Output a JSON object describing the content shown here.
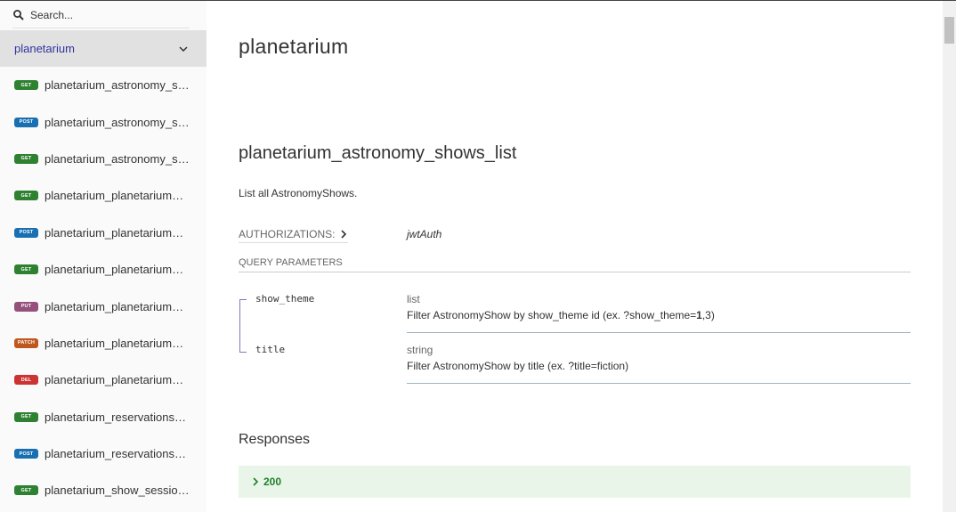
{
  "sidebar": {
    "search_placeholder": "Search...",
    "group_label": "planetarium",
    "operations": [
      {
        "method": "GET",
        "label": "planetarium_astronomy_shows_list"
      },
      {
        "method": "POST",
        "label": "planetarium_astronomy_shows_create"
      },
      {
        "method": "GET",
        "label": "planetarium_astronomy_shows_retrieve"
      },
      {
        "method": "GET",
        "label": "planetarium_planetarium_domes_list"
      },
      {
        "method": "POST",
        "label": "planetarium_planetarium_domes_create"
      },
      {
        "method": "GET",
        "label": "planetarium_planetarium_domes_retrieve"
      },
      {
        "method": "PUT",
        "label": "planetarium_planetarium_domes_update"
      },
      {
        "method": "PATCH",
        "label": "planetarium_planetarium_domes_partial_update"
      },
      {
        "method": "DEL",
        "label": "planetarium_planetarium_domes_destroy"
      },
      {
        "method": "GET",
        "label": "planetarium_reservations_list"
      },
      {
        "method": "POST",
        "label": "planetarium_reservations_create"
      },
      {
        "method": "GET",
        "label": "planetarium_show_sessions_list"
      }
    ]
  },
  "method_colors": {
    "GET": "#2f8132",
    "POST": "#186fb1",
    "PUT": "#95507c",
    "PATCH": "#bf581d",
    "DEL": "#cc3333"
  },
  "main": {
    "page_title": "planetarium",
    "operation_title": "planetarium_astronomy_shows_list",
    "operation_description": "List all AstronomyShows.",
    "authorizations_label": "AUTHORIZATIONS:",
    "authorizations_value": "jwtAuth",
    "query_params_title": "QUERY PARAMETERS",
    "params": [
      {
        "name": "show_theme",
        "type": "list",
        "description_prefix": "Filter AstronomyShow by show_theme id (ex. ?show_theme=",
        "description_bold": "1",
        "description_suffix": ",3)"
      },
      {
        "name": "title",
        "type": "string",
        "description_prefix": "Filter AstronomyShow by title (ex. ?title=fiction)",
        "description_bold": "",
        "description_suffix": ""
      }
    ],
    "responses_title": "Responses",
    "response_code": "200"
  }
}
